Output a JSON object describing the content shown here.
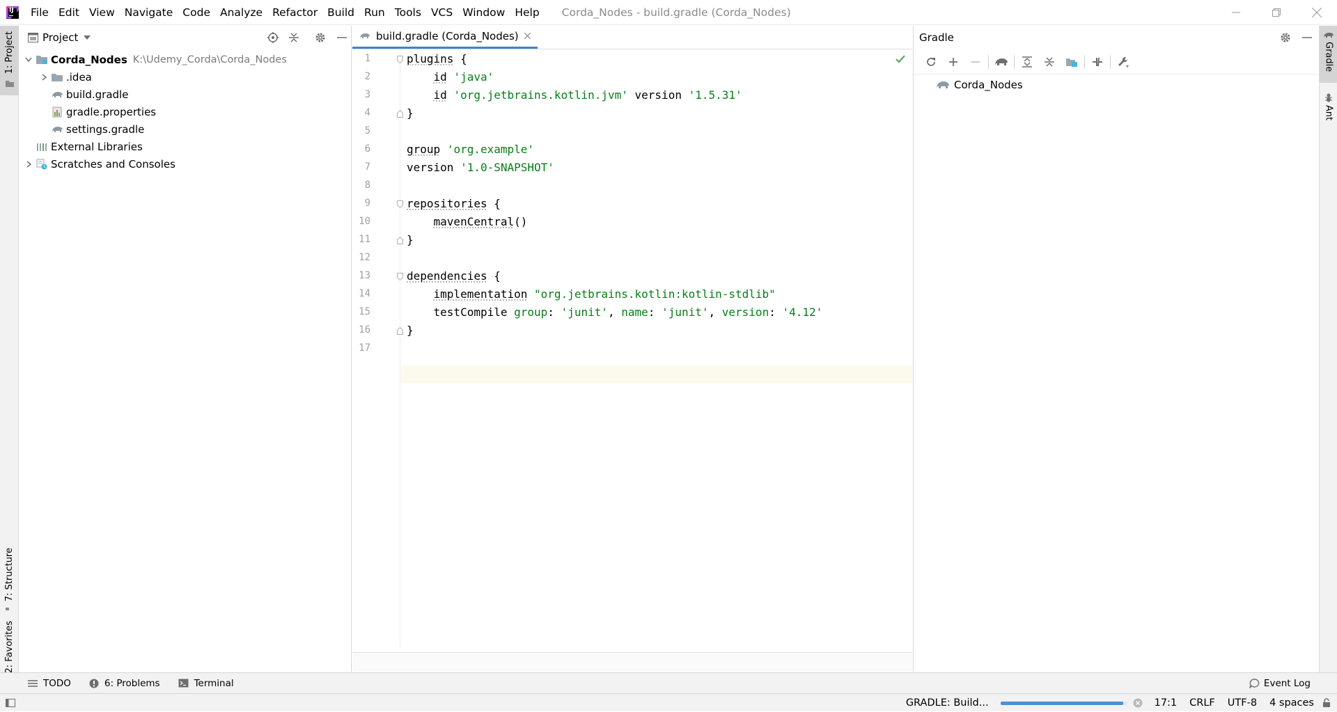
{
  "menu": {
    "items": [
      "File",
      "Edit",
      "View",
      "Navigate",
      "Code",
      "Analyze",
      "Refactor",
      "Build",
      "Run",
      "Tools",
      "VCS",
      "Window",
      "Help"
    ],
    "window_title": "Corda_Nodes - build.gradle (Corda_Nodes)"
  },
  "left_strip": {
    "project_tab": "1: Project",
    "structure_tab": "7: Structure",
    "favorites_tab": "2: Favorites"
  },
  "project_panel": {
    "title": "Project",
    "tree": [
      {
        "label": "Corda_Nodes",
        "path": "K:\\Udemy_Corda\\Corda_Nodes",
        "icon": "module-folder-icon",
        "expanded": true,
        "depth": 0,
        "bold": true
      },
      {
        "label": ".idea",
        "icon": "folder-icon",
        "expanded": false,
        "depth": 1
      },
      {
        "label": "build.gradle",
        "icon": "gradle-elephant-icon",
        "depth": 1
      },
      {
        "label": "gradle.properties",
        "icon": "properties-file-icon",
        "depth": 1
      },
      {
        "label": "settings.gradle",
        "icon": "gradle-elephant-icon",
        "depth": 1
      },
      {
        "label": "External Libraries",
        "icon": "libraries-icon",
        "depth": 0
      },
      {
        "label": "Scratches and Consoles",
        "icon": "scratches-icon",
        "expanded": false,
        "depth": 0
      }
    ]
  },
  "editor": {
    "tab_label": "build.gradle (Corda_Nodes)",
    "line_numbers": [
      "1",
      "2",
      "3",
      "4",
      "5",
      "6",
      "7",
      "8",
      "9",
      "10",
      "11",
      "12",
      "13",
      "14",
      "15",
      "16",
      "17"
    ],
    "current_line": 17
  },
  "gradle_panel": {
    "title": "Gradle",
    "root_project": "Corda_Nodes"
  },
  "right_strip": {
    "gradle_tab": "Gradle",
    "ant_tab": "Ant"
  },
  "bottom_tools": {
    "todo": "TODO",
    "problems": "6: Problems",
    "terminal": "Terminal",
    "event_log": "Event Log"
  },
  "status_bar": {
    "task": "GRADLE: Build...",
    "progress_percent": 97,
    "position": "17:1",
    "line_separator": "CRLF",
    "encoding": "UTF-8",
    "indent": "4 spaces"
  },
  "colors": {
    "string": "#067d17",
    "accent": "#4083c9",
    "check": "#59a869"
  }
}
